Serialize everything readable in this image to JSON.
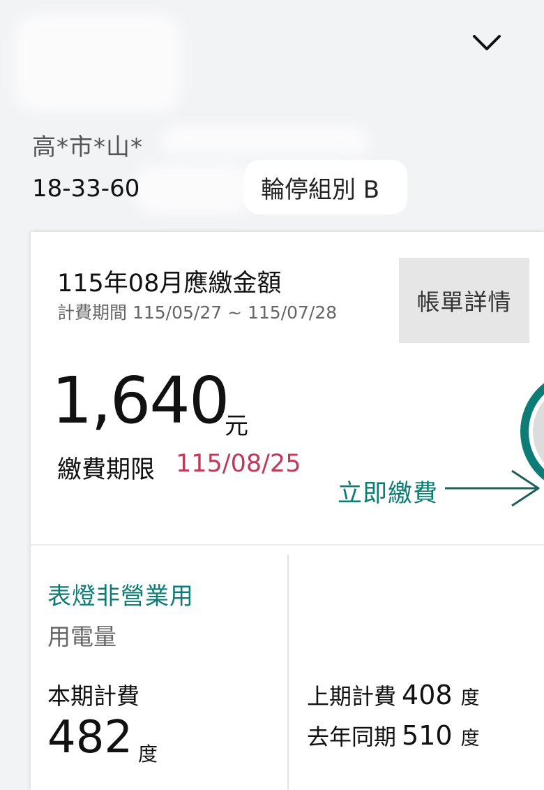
{
  "header": {
    "address": "高*市*山*",
    "account_prefix": "18-33-60",
    "rotation_group": "輪停組別 B"
  },
  "bill": {
    "title": "115年08月應繳金額",
    "period": "計費期間 115/05/27 ~ 115/07/28",
    "details_button": "帳單詳情",
    "amount": "1,640",
    "amount_unit": "元",
    "due_label": "繳費期限",
    "due_date": "115/08/25",
    "pay_now_label": "立即繳費"
  },
  "usage": {
    "type": "表燈非營業用",
    "label": "用電量",
    "current_label": "本期計費",
    "current_value": "482",
    "current_unit": "度",
    "previous_label": "上期計費",
    "previous_value": "408",
    "previous_unit": "度",
    "last_year_label": "去年同期",
    "last_year_value": "510",
    "last_year_unit": "度"
  },
  "colors": {
    "accent_teal": "#0d7c74",
    "due_date": "#c0395a",
    "background": "#f2f3f5"
  },
  "icons": {
    "expand": "chevron-down-icon",
    "pay_arrow": "arrow-right-icon"
  }
}
